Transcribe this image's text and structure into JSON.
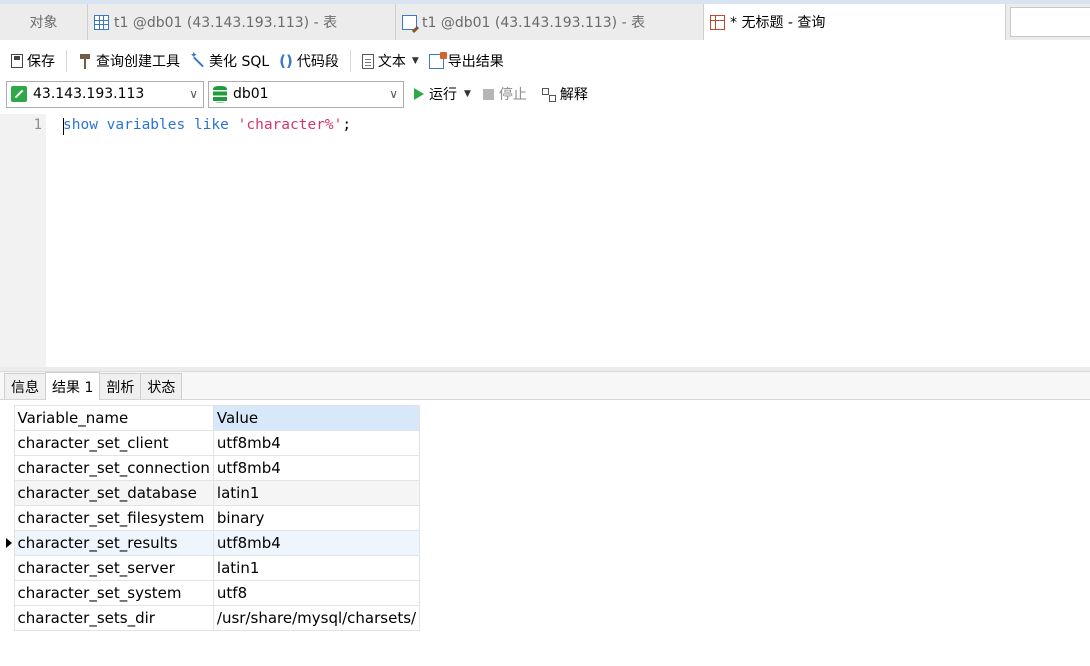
{
  "tabs": [
    {
      "label": "对象",
      "icon": "none"
    },
    {
      "label": "t1 @db01 (43.143.193.113) - 表",
      "icon": "table-grid-icon"
    },
    {
      "label": "t1 @db01 (43.143.193.113) - 表",
      "icon": "table-edit-icon"
    },
    {
      "label": "* 无标题 - 查询",
      "icon": "query-icon"
    }
  ],
  "toolbar": {
    "save": "保存",
    "query_builder": "查询创建工具",
    "beautify_sql": "美化 SQL",
    "code_snippet": "代码段",
    "text": "文本",
    "export_result": "导出结果"
  },
  "connection": {
    "host": "43.143.193.113",
    "database": "db01",
    "run": "运行",
    "stop": "停止",
    "explain": "解释"
  },
  "editor": {
    "line_number": "1",
    "tokens": {
      "kw1": "show",
      "kw2": "variables",
      "kw3": "like",
      "str": "'character%'",
      "punc": ";"
    }
  },
  "result_tabs": [
    "信息",
    "结果 1",
    "剖析",
    "状态"
  ],
  "result": {
    "columns": [
      "Variable_name",
      "Value"
    ],
    "rows": [
      [
        "character_set_client",
        "utf8mb4"
      ],
      [
        "character_set_connection",
        "utf8mb4"
      ],
      [
        "character_set_database",
        "latin1"
      ],
      [
        "character_set_filesystem",
        "binary"
      ],
      [
        "character_set_results",
        "utf8mb4"
      ],
      [
        "character_set_server",
        "latin1"
      ],
      [
        "character_set_system",
        "utf8"
      ],
      [
        "character_sets_dir",
        "/usr/share/mysql/charsets/"
      ]
    ],
    "selected_row": 4
  }
}
